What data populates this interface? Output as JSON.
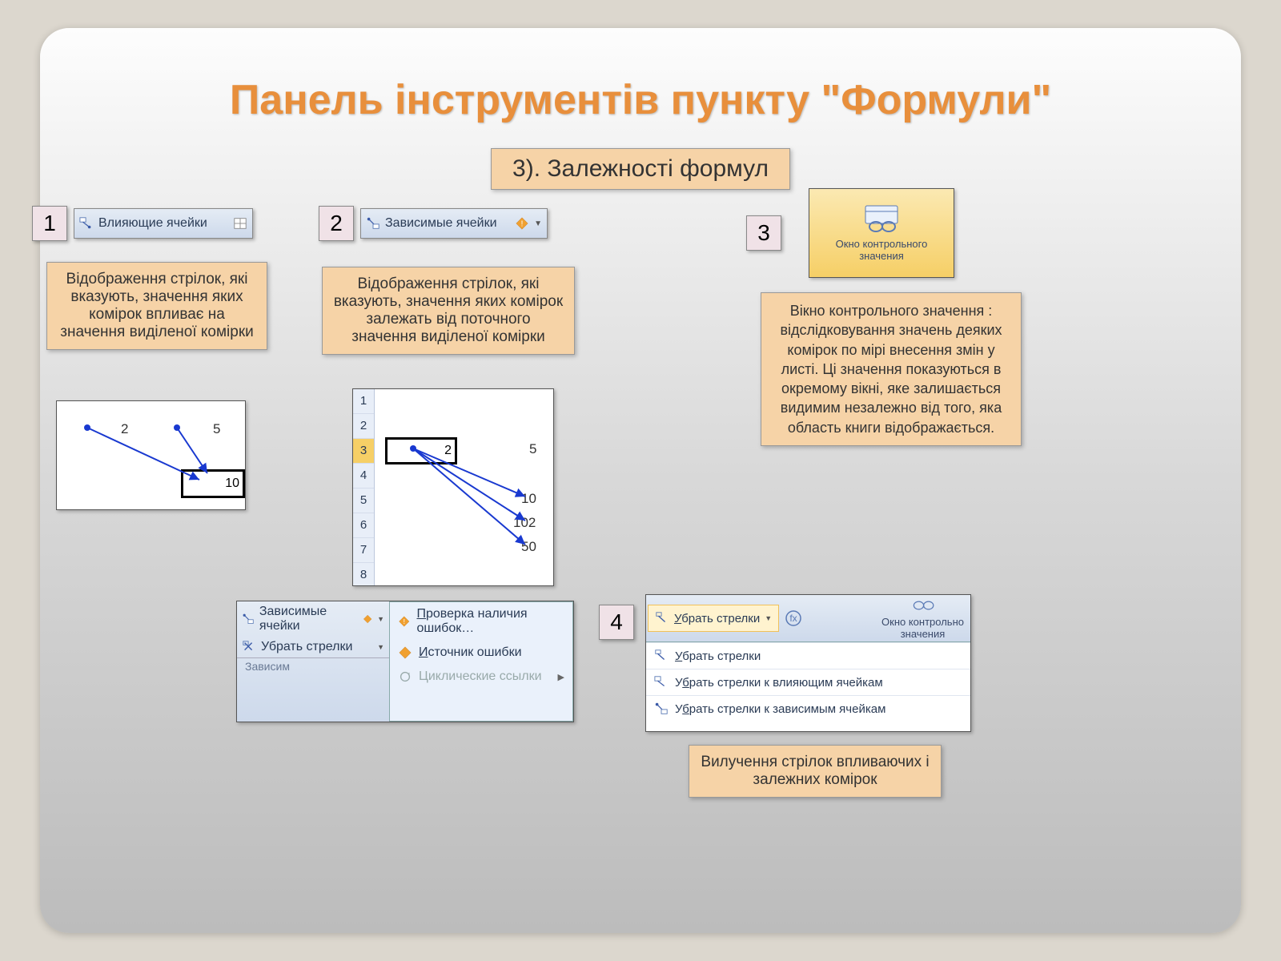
{
  "title": "Панель інструментів пункту \"Формули\"",
  "subtitle": "3). Залежності формул",
  "sec1": {
    "num": "1",
    "btn": "Влияющие ячейки",
    "desc": "Відображення стрілок, які вказують, значення яких комірок впливає на значення виділеної комірки",
    "cells": {
      "a": "2",
      "b": "5",
      "r": "10"
    }
  },
  "sec2": {
    "num": "2",
    "btn": "Зависимые ячейки",
    "desc": "Відображення стрілок, які вказують, значення яких комірок залежать від поточного значення виділеної комірки",
    "rows": [
      "1",
      "2",
      "3",
      "4",
      "5",
      "6",
      "7",
      "8"
    ],
    "vals": {
      "r3a": "2",
      "r3b": "5",
      "r5": "10",
      "r6": "102",
      "r7": "50"
    }
  },
  "sec3": {
    "num": "3",
    "card_l1": "Окно контрольного",
    "card_l2": "значения",
    "desc": "Вікно контрольного значення : відслідковування значень деяких комірок по мірі внесення змін у листі. Ці значення показуються в окремому вікні, яке залишається видимим незалежно від того,  яка область книги відображається."
  },
  "errbox": {
    "left1": "Зависимые ячейки",
    "left2": "Убрать стрелки",
    "group": "Зависим",
    "m1": "Проверка наличия ошибок…",
    "m2": "Источник ошибки",
    "m3": "Циклические ссылки"
  },
  "sec4": {
    "num": "4",
    "hbtn": "Убрать стрелки",
    "wlabel": "Окно контрольно\nзначения",
    "i1": "Убрать стрелки",
    "i2": "Убрать стрелки к влияющим ячейкам",
    "i3": "Убрать стрелки к зависимым ячейкам",
    "desc": "Вилучення стрілок впливаючих і залежних комірок"
  }
}
